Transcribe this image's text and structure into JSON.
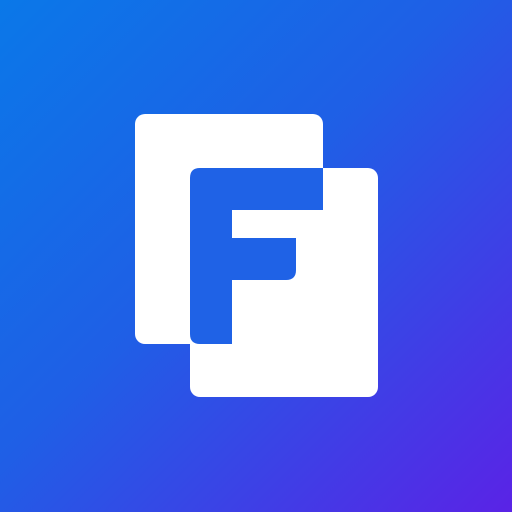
{
  "app": {
    "icon": "f-logo-icon"
  },
  "colors": {
    "background_start": "#0a78e8",
    "background_mid": "#1f5fe6",
    "background_end": "#5a23e6",
    "logo_white": "#ffffff",
    "logo_blue": "#1f62e6"
  }
}
